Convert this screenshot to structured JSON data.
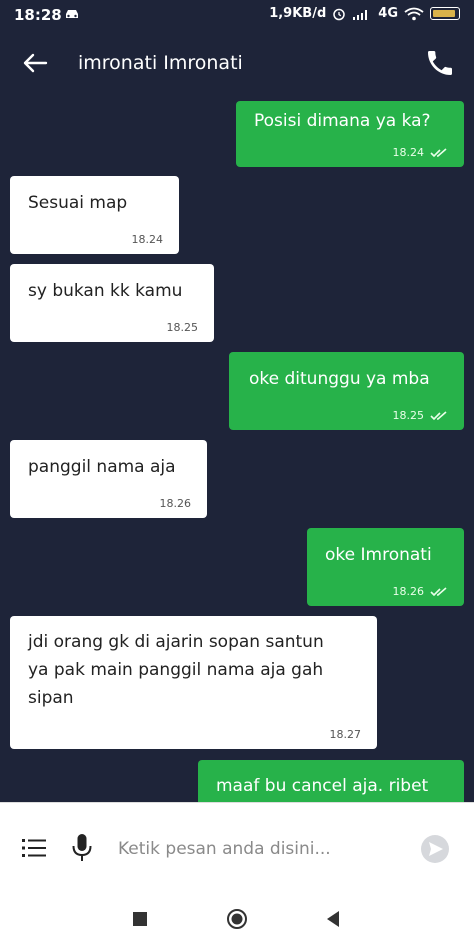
{
  "status_bar": {
    "time": "18:28",
    "speed": "1,9KB/d",
    "network": "4G",
    "network_sub": "ill",
    "battery_level": "70",
    "battery_color": "#d9b24a"
  },
  "header": {
    "contact_name": "imronati Imronati"
  },
  "messages": [
    {
      "dir": "out",
      "text": "Posisi dimana ya ka?",
      "time": "18.24",
      "ticks": "double-check-icon"
    },
    {
      "dir": "in",
      "text": "Sesuai map",
      "time": "18.24"
    },
    {
      "dir": "in",
      "text": "sy bukan kk kamu",
      "time": "18.25"
    },
    {
      "dir": "out",
      "text": "oke ditunggu ya mba",
      "time": "18.25",
      "ticks": "double-check-icon"
    },
    {
      "dir": "in",
      "text": "panggil nama aja",
      "time": "18.26"
    },
    {
      "dir": "out",
      "text": "oke Imronati",
      "time": "18.26",
      "ticks": "double-check-icon"
    },
    {
      "dir": "in",
      "text": "jdi orang gk di ajarin sopan santun\nya pak main panggil nama aja gah\nsipan",
      "time": "18.27"
    },
    {
      "dir": "out",
      "text": "maaf bu cancel aja. ribet",
      "time": ""
    }
  ],
  "composer": {
    "placeholder": "Ketik pesan anda disini..."
  },
  "colors": {
    "background": "#1e2439",
    "outgoing_bubble": "#27b24a",
    "incoming_bubble": "#ffffff"
  },
  "icons": [
    "car-icon",
    "alarm-icon",
    "signal-icon",
    "wifi-icon",
    "battery-icon",
    "back-arrow-icon",
    "phone-icon",
    "menu-list-icon",
    "microphone-icon",
    "send-icon",
    "nav-recent-icon",
    "nav-home-icon",
    "nav-back-icon"
  ]
}
